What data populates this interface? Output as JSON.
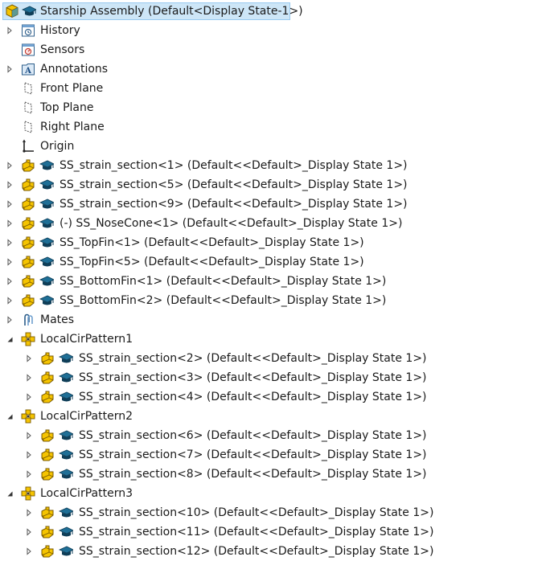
{
  "tree": {
    "root": {
      "label": "Starship Assembly  (Default<Display State-1>)",
      "selected": true
    },
    "items": [
      {
        "id": "history",
        "label": "History",
        "icon": "history-icon",
        "expander": "collapsed",
        "depth": 0
      },
      {
        "id": "sensors",
        "label": "Sensors",
        "icon": "sensor-icon",
        "expander": "none",
        "depth": 0
      },
      {
        "id": "annotations",
        "label": "Annotations",
        "icon": "annotation-icon",
        "expander": "collapsed",
        "depth": 0
      },
      {
        "id": "front-plane",
        "label": "Front Plane",
        "icon": "plane-icon",
        "expander": "none",
        "depth": 0
      },
      {
        "id": "top-plane",
        "label": "Top Plane",
        "icon": "plane-icon",
        "expander": "none",
        "depth": 0
      },
      {
        "id": "right-plane",
        "label": "Right Plane",
        "icon": "plane-icon",
        "expander": "none",
        "depth": 0
      },
      {
        "id": "origin",
        "label": "Origin",
        "icon": "origin-icon",
        "expander": "none",
        "depth": 0
      },
      {
        "id": "ss1",
        "label": "SS_strain_section<1> (Default<<Default>_Display State 1>)",
        "icon": "part-icon",
        "expander": "collapsed",
        "depth": 0
      },
      {
        "id": "ss5",
        "label": "SS_strain_section<5> (Default<<Default>_Display State 1>)",
        "icon": "part-icon",
        "expander": "collapsed",
        "depth": 0
      },
      {
        "id": "ss9",
        "label": "SS_strain_section<9> (Default<<Default>_Display State 1>)",
        "icon": "part-icon",
        "expander": "collapsed",
        "depth": 0
      },
      {
        "id": "nose",
        "label": "(-) SS_NoseCone<1> (Default<<Default>_Display State 1>)",
        "icon": "part-icon",
        "expander": "collapsed",
        "depth": 0
      },
      {
        "id": "topfin1",
        "label": "SS_TopFin<1> (Default<<Default>_Display State 1>)",
        "icon": "part-icon",
        "expander": "collapsed",
        "depth": 0
      },
      {
        "id": "topfin5",
        "label": "SS_TopFin<5> (Default<<Default>_Display State 1>)",
        "icon": "part-icon",
        "expander": "collapsed",
        "depth": 0
      },
      {
        "id": "botfin1",
        "label": "SS_BottomFin<1> (Default<<Default>_Display State 1>)",
        "icon": "part-icon",
        "expander": "collapsed",
        "depth": 0
      },
      {
        "id": "botfin2",
        "label": "SS_BottomFin<2> (Default<<Default>_Display State 1>)",
        "icon": "part-icon",
        "expander": "collapsed",
        "depth": 0
      },
      {
        "id": "mates",
        "label": "Mates",
        "icon": "mates-icon",
        "expander": "collapsed",
        "depth": 0
      },
      {
        "id": "pat1",
        "label": "LocalCirPattern1",
        "icon": "pattern-icon",
        "expander": "expanded",
        "depth": 0
      },
      {
        "id": "ss2",
        "label": "SS_strain_section<2> (Default<<Default>_Display State 1>)",
        "icon": "part-icon",
        "expander": "collapsed",
        "depth": 1
      },
      {
        "id": "ss3",
        "label": "SS_strain_section<3> (Default<<Default>_Display State 1>)",
        "icon": "part-icon",
        "expander": "collapsed",
        "depth": 1
      },
      {
        "id": "ss4",
        "label": "SS_strain_section<4> (Default<<Default>_Display State 1>)",
        "icon": "part-icon",
        "expander": "collapsed",
        "depth": 1
      },
      {
        "id": "pat2",
        "label": "LocalCirPattern2",
        "icon": "pattern-icon",
        "expander": "expanded",
        "depth": 0
      },
      {
        "id": "ss6",
        "label": "SS_strain_section<6> (Default<<Default>_Display State 1>)",
        "icon": "part-icon",
        "expander": "collapsed",
        "depth": 1
      },
      {
        "id": "ss7",
        "label": "SS_strain_section<7> (Default<<Default>_Display State 1>)",
        "icon": "part-icon",
        "expander": "collapsed",
        "depth": 1
      },
      {
        "id": "ss8",
        "label": "SS_strain_section<8> (Default<<Default>_Display State 1>)",
        "icon": "part-icon",
        "expander": "collapsed",
        "depth": 1
      },
      {
        "id": "pat3",
        "label": "LocalCirPattern3",
        "icon": "pattern-icon",
        "expander": "expanded",
        "depth": 0
      },
      {
        "id": "ss10",
        "label": "SS_strain_section<10> (Default<<Default>_Display State 1>)",
        "icon": "part-icon",
        "expander": "collapsed",
        "depth": 1
      },
      {
        "id": "ss11",
        "label": "SS_strain_section<11> (Default<<Default>_Display State 1>)",
        "icon": "part-icon",
        "expander": "collapsed",
        "depth": 1
      },
      {
        "id": "ss12",
        "label": "SS_strain_section<12> (Default<<Default>_Display State 1>)",
        "icon": "part-icon",
        "expander": "collapsed",
        "depth": 1
      }
    ]
  },
  "colors": {
    "selection_bg": "#cde6f7",
    "selection_border": "#99c9ef",
    "part_yellow": "#f5c400",
    "part_outline": "#7a5a00",
    "cap_teal": "#1f6f96",
    "cap_dark": "#0f3e58"
  }
}
